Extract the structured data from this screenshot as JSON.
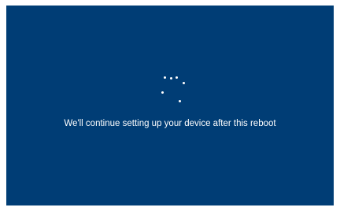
{
  "setup_screen": {
    "message": "We'll continue setting up your device after this reboot",
    "spinner_icon": "loading-dots-icon",
    "colors": {
      "background": "#003d75",
      "text": "#ffffff"
    }
  }
}
